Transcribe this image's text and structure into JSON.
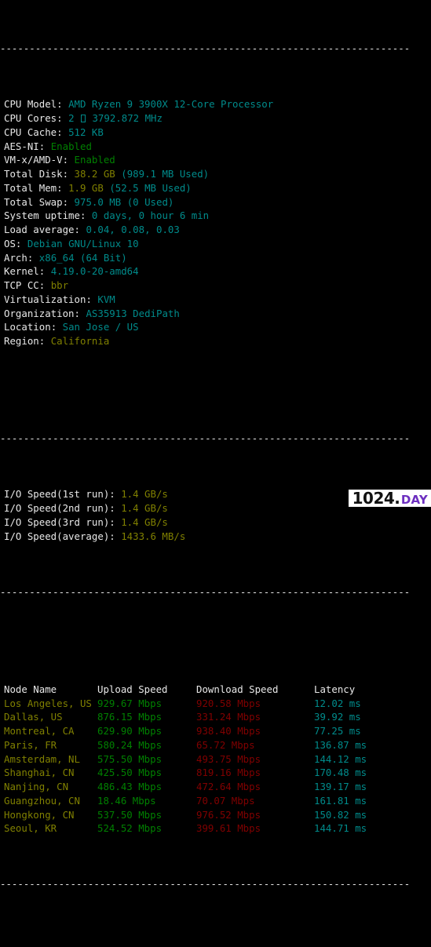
{
  "terminal": {
    "separator": "----------------------------------------------------------------------",
    "colon": ":"
  },
  "sysinfo": {
    "rows": [
      {
        "label": "CPU Model",
        "value": "AMD Ryzen 9 3900X 12-Core Processor",
        "color": "cyan"
      },
      {
        "label": "CPU Cores",
        "value": "2 @ 3792.872 MHz",
        "color": "cyan",
        "glyph": "missing-glyph-box"
      },
      {
        "label": "CPU Cache",
        "value": "512 KB",
        "color": "cyan"
      },
      {
        "label": "AES-NI",
        "value": "Enabled",
        "color": "green"
      },
      {
        "label": "VM-x/AMD-V",
        "value": "Enabled",
        "color": "green"
      },
      {
        "label": "Total Disk",
        "value": "38.2 GB",
        "value2": "(989.1 MB Used)",
        "color": "olive",
        "color2": "cyan"
      },
      {
        "label": "Total Mem",
        "value": "1.9 GB",
        "value2": "(52.5 MB Used)",
        "color": "olive",
        "color2": "cyan"
      },
      {
        "label": "Total Swap",
        "value": "975.0 MB",
        "value2": "(0 Used)",
        "color": "cyan",
        "color2": "cyan"
      },
      {
        "label": "System uptime",
        "value": "0 days, 0 hour 6 min",
        "color": "cyan"
      },
      {
        "label": "Load average",
        "value": "0.04, 0.08, 0.03",
        "color": "cyan"
      },
      {
        "label": "OS",
        "value": "Debian GNU/Linux 10",
        "color": "cyan"
      },
      {
        "label": "Arch",
        "value": "x86_64 (64 Bit)",
        "color": "cyan"
      },
      {
        "label": "Kernel",
        "value": "4.19.0-20-amd64",
        "color": "cyan"
      },
      {
        "label": "TCP CC",
        "value": "bbr",
        "color": "olive"
      },
      {
        "label": "Virtualization",
        "value": "KVM",
        "color": "cyan"
      },
      {
        "label": "Organization",
        "value": "AS35913 DediPath",
        "color": "cyan"
      },
      {
        "label": "Location",
        "value": "San Jose / US",
        "color": "cyan"
      },
      {
        "label": "Region",
        "value": "California",
        "color": "olive"
      }
    ]
  },
  "iospeed": {
    "rows": [
      {
        "label": "I/O Speed(1st run)",
        "value": "1.4 GB/s"
      },
      {
        "label": "I/O Speed(2nd run)",
        "value": "1.4 GB/s"
      },
      {
        "label": "I/O Speed(3rd run)",
        "value": "1.4 GB/s"
      },
      {
        "label": "I/O Speed(average)",
        "value": "1433.6 MB/s"
      }
    ]
  },
  "speedtest": {
    "headers": {
      "node": "Node Name",
      "upload": "Upload Speed",
      "download": "Download Speed",
      "latency": "Latency"
    },
    "rows": [
      {
        "node": "Los Angeles, US",
        "upload": "929.67 Mbps",
        "download": "920.58 Mbps",
        "latency": "12.02 ms"
      },
      {
        "node": "Dallas, US",
        "upload": "876.15 Mbps",
        "download": "331.24 Mbps",
        "latency": "39.92 ms"
      },
      {
        "node": "Montreal, CA",
        "upload": "629.90 Mbps",
        "download": "938.40 Mbps",
        "latency": "77.25 ms"
      },
      {
        "node": "Paris, FR",
        "upload": "580.24 Mbps",
        "download": "65.72 Mbps",
        "latency": "136.87 ms"
      },
      {
        "node": "Amsterdam, NL",
        "upload": "575.50 Mbps",
        "download": "493.75 Mbps",
        "latency": "144.12 ms"
      },
      {
        "node": "Shanghai, CN",
        "upload": "425.50 Mbps",
        "download": "819.16 Mbps",
        "latency": "170.48 ms"
      },
      {
        "node": "Nanjing, CN",
        "upload": "486.43 Mbps",
        "download": "472.64 Mbps",
        "latency": "139.17 ms"
      },
      {
        "node": "Guangzhou, CN",
        "upload": "18.46 Mbps",
        "download": "70.07 Mbps",
        "latency": "161.81 ms"
      },
      {
        "node": "Hongkong, CN",
        "upload": "537.50 Mbps",
        "download": "976.52 Mbps",
        "latency": "150.82 ms"
      },
      {
        "node": "Seoul, KR",
        "upload": "524.52 Mbps",
        "download": "399.61 Mbps",
        "latency": "144.71 ms"
      }
    ]
  },
  "watermark": {
    "number": "1024",
    "dot": ".",
    "suffix": "DAY",
    "accent_color": "#6d2fc0"
  },
  "colors": {
    "background": "#000000",
    "label": "#e8e8e8",
    "cyan": "#008b8b",
    "green": "#008000",
    "olive": "#808000",
    "red": "#800000",
    "separator": "#e6e6e6"
  }
}
